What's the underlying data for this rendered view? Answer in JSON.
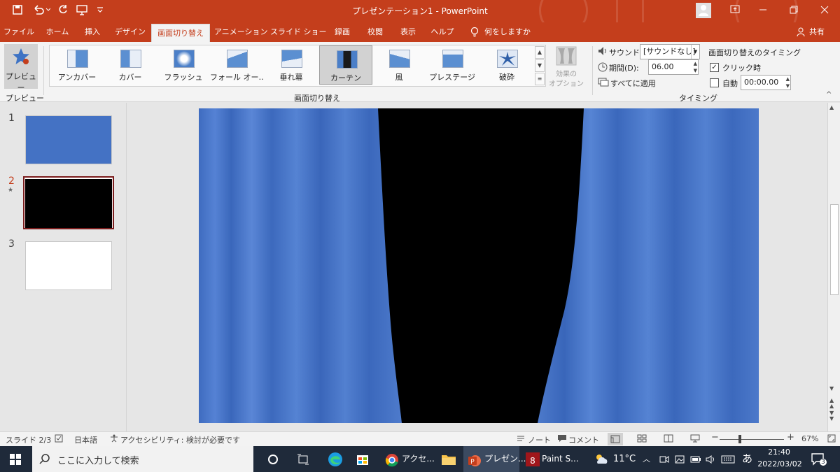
{
  "window": {
    "title": "プレゼンテーション1 - PowerPoint"
  },
  "quick_access": {
    "save_icon": "save-icon",
    "undo_icon": "undo-icon",
    "redo_icon": "redo-icon",
    "present_icon": "present-icon"
  },
  "account": {
    "share_label": "共有"
  },
  "tabs": [
    "ファイル",
    "ホーム",
    "挿入",
    "デザイン",
    "画面切り替え",
    "アニメーション",
    "スライド ショー",
    "録画",
    "校閲",
    "表示",
    "ヘルプ"
  ],
  "active_tab": "画面切り替え",
  "tell_me": "何をしますか",
  "ribbon": {
    "preview_label": "プレビュー",
    "preview_group": "プレビュー",
    "transitions_group": "画面切り替え",
    "timing_group": "タイミング",
    "gallery": [
      {
        "label": "アンカバー",
        "icon": "uncover-icon"
      },
      {
        "label": "カバー",
        "icon": "cover-icon"
      },
      {
        "label": "フラッシュ",
        "icon": "flash-icon"
      },
      {
        "label": "フォール オー…",
        "icon": "fall-over-icon"
      },
      {
        "label": "垂れ幕",
        "icon": "drape-icon"
      },
      {
        "label": "カーテン",
        "icon": "curtain-icon"
      },
      {
        "label": "風",
        "icon": "wind-icon"
      },
      {
        "label": "プレステージ",
        "icon": "prestige-icon"
      },
      {
        "label": "破砕",
        "icon": "fracture-icon"
      }
    ],
    "selected_transition": "カーテン",
    "effect_options_label": [
      "効果の",
      "オプション"
    ],
    "sound_label": "サウンド:",
    "sound_value": "[サウンドなし]",
    "duration_label": "期間(D):",
    "duration_value": "06.00",
    "apply_all_label": "すべてに適用",
    "advance_title": "画面切り替えのタイミング",
    "on_click_label": "クリック時",
    "on_click_checked": true,
    "after_label": "自動",
    "after_checked": false,
    "after_value": "00:00.00"
  },
  "slides": [
    {
      "number": "1",
      "color": "#4472c4",
      "selected": false
    },
    {
      "number": "2",
      "color": "#000000",
      "selected": true
    },
    {
      "number": "3",
      "color": "#ffffff",
      "selected": false
    }
  ],
  "slide_view": {
    "background": "#000000",
    "curtain_color": "#4472c4"
  },
  "status": {
    "slide_info": "スライド 2/3",
    "language": "日本語",
    "accessibility": "アクセシビリティ: 検討が必要です",
    "notes_label": "ノート",
    "comments_label": "コメント",
    "zoom_minus": "−",
    "zoom_plus": "+",
    "zoom_value": "67%",
    "zoom_percent": 67
  },
  "taskbar": {
    "search_placeholder": "ここに入力して検索",
    "apps": [
      {
        "label": "アクセ...",
        "icon": "chrome-icon"
      },
      {
        "label": "プレゼン...",
        "icon": "powerpoint-icon"
      },
      {
        "label": "Paint S...",
        "icon": "paint-shop-icon"
      }
    ],
    "weather": "11°C",
    "ime": "あ",
    "time": "21:40",
    "date": "2022/03/02",
    "notification_count": "3"
  },
  "colors": {
    "accent": "#c43e1c",
    "ribbon_bg": "#f3f3f3",
    "taskbar_bg": "#1f2a3a",
    "selection_border": "#7b1d1d"
  }
}
